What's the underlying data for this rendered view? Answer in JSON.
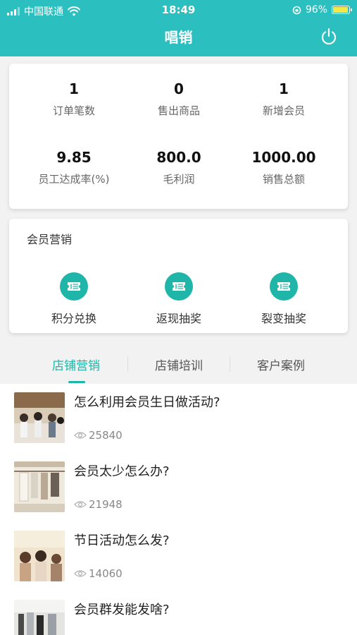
{
  "status_bar": {
    "carrier": "中国联通",
    "time": "18:49",
    "battery": "96%",
    "battery_level": 0.96
  },
  "nav": {
    "title": "唱销",
    "power_icon": "power-icon"
  },
  "stats": [
    {
      "value": "1",
      "label": "订单笔数"
    },
    {
      "value": "0",
      "label": "售出商品"
    },
    {
      "value": "1",
      "label": "新增会员"
    },
    {
      "value": "9.85",
      "label": "员工达成率(%)"
    },
    {
      "value": "800.0",
      "label": "毛利润"
    },
    {
      "value": "1000.00",
      "label": "销售总额"
    }
  ],
  "member_marketing": {
    "title": "会员营销",
    "items": [
      {
        "label": "积分兑换",
        "icon": "ticket-icon"
      },
      {
        "label": "返现抽奖",
        "icon": "ticket-icon"
      },
      {
        "label": "裂变抽奖",
        "icon": "ticket-icon"
      }
    ]
  },
  "tabs": [
    {
      "label": "店铺营销",
      "active": true
    },
    {
      "label": "店铺培训",
      "active": false
    },
    {
      "label": "客户案例",
      "active": false
    }
  ],
  "articles": [
    {
      "title": "怎么利用会员生日做活动?",
      "views": "25840"
    },
    {
      "title": "会员太少怎么办?",
      "views": "21948"
    },
    {
      "title": "节日活动怎么发?",
      "views": "14060"
    },
    {
      "title": "会员群发能发啥?",
      "views": ""
    }
  ],
  "colors": {
    "primary": "#2bbfbf",
    "accent": "#1fb5a8"
  }
}
